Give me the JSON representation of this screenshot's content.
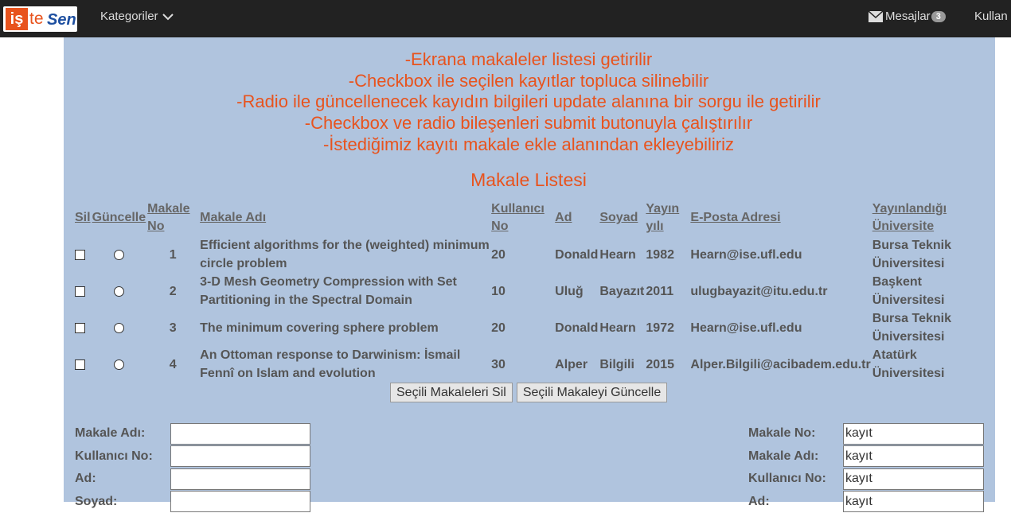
{
  "brand": {
    "mark": "iş",
    "te": "te",
    "sen": "Sen"
  },
  "nav": {
    "categories": "Kategoriler",
    "messages": "Mesajlar",
    "messages_count": "3",
    "user": "Kullan"
  },
  "intro_lines": [
    "-Ekrana makaleler listesi getirilir",
    "-Checkbox ile seçilen kayıtlar topluca silinebilir",
    "-Radio ile güncellenecek kayıdın bilgileri update alanına bir sorgu ile getirilir",
    "-Checkbox ve radio bileşenleri submit butonuyla çalıştırılır",
    "-İstediğimiz kayıtı makale ekle alanından ekleyebiliriz"
  ],
  "list_title": "Makale Listesi",
  "table": {
    "headers": {
      "sil": "Sil",
      "guncelle": "Güncelle",
      "makale_no": "Makale No",
      "makale_adi": "Makale Adı",
      "kullanici_no": "Kullanıcı No",
      "ad": "Ad",
      "soyad": "Soyad",
      "yayin_yili": "Yayın yılı",
      "eposta": "E-Posta Adresi",
      "universite": "Yayınlandığı Üniversite"
    },
    "rows": [
      {
        "no": "1",
        "title": "Efficient algorithms for the (weighted) minimum circle problem",
        "user_no": "20",
        "ad": "Donald",
        "soyad": "Hearn",
        "year": "1982",
        "email": "Hearn@ise.ufl.edu",
        "university": "Bursa Teknik Üniversitesi"
      },
      {
        "no": "2",
        "title": "3-D Mesh Geometry Compression with Set Partitioning in the Spectral Domain",
        "user_no": "10",
        "ad": "Uluğ",
        "soyad": "Bayazıt",
        "year": "2011",
        "email": "ulugbayazit@itu.edu.tr",
        "university": "Başkent Üniversitesi"
      },
      {
        "no": "3",
        "title": "The minimum covering sphere problem",
        "user_no": "20",
        "ad": "Donald",
        "soyad": "Hearn",
        "year": "1972",
        "email": "Hearn@ise.ufl.edu",
        "university": "Bursa Teknik Üniversitesi"
      },
      {
        "no": "4",
        "title": "An Ottoman response to Darwinism: İsmail Fennî on Islam and evolution",
        "user_no": "30",
        "ad": "Alper",
        "soyad": "Bilgili",
        "year": "2015",
        "email": "Alper.Bilgili@acibadem.edu.tr",
        "university": "Atatürk Üniversitesi"
      }
    ]
  },
  "buttons": {
    "delete_selected": "Seçili Makaleleri Sil",
    "update_selected": "Seçili Makaleyi Güncelle"
  },
  "add_form": {
    "labels": [
      "Makale Adı:",
      "Kullanıcı No:",
      "Ad:",
      "Soyad:"
    ],
    "values": [
      "",
      "",
      "",
      ""
    ]
  },
  "update_form": {
    "labels": [
      "Makale No:",
      "Makale Adı:",
      "Kullanıcı No:",
      "Ad:"
    ],
    "values": [
      "kayıt",
      "kayıt",
      "kayıt",
      "kayıt"
    ]
  },
  "colors": {
    "topbar": "#222222",
    "panel": "#b0c4de",
    "accent": "#e8531d"
  }
}
